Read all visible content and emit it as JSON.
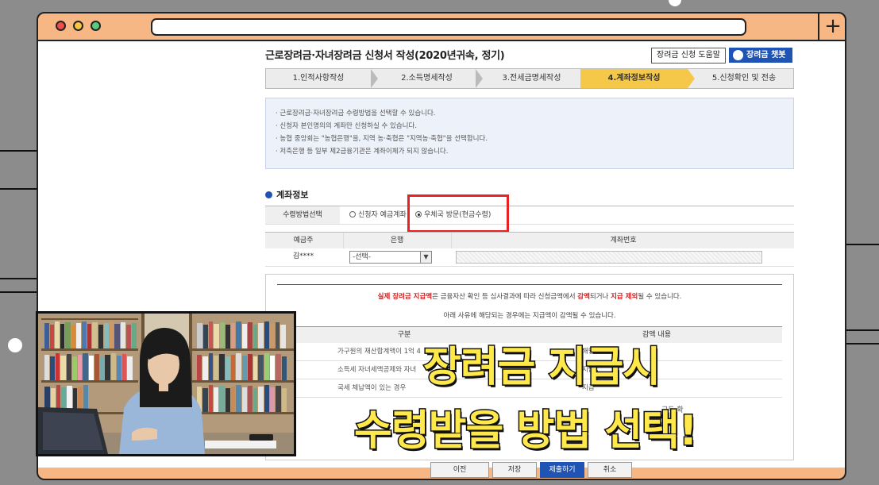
{
  "browser": {
    "window_buttons": [
      "close",
      "minimize",
      "maximize"
    ],
    "new_tab_label": "+"
  },
  "form": {
    "title": "근로장려금·자녀장려금 신청서 작성(2020년귀속, 정기)",
    "help_button": "장려금 신청 도움말",
    "chatbot_button": "장려금 챗봇",
    "steps": [
      "1.인적사항작성",
      "2.소득명세작성",
      "3.전세금명세작성",
      "4.계좌정보작성",
      "5.신청확인 및 전송"
    ],
    "active_step": 4,
    "info_lines": [
      "근로장려금·자녀장려금 수령방법을 선택할 수 있습니다.",
      "신청자 본인명의의 계좌만 신청하실 수 있습니다.",
      "농협 중앙회는 \"농협은행\"을, 지역 농·축협은 \"지역농·축협\"을 선택합니다.",
      "저축은행 등 일부 제2금융기관은 계좌이체가 되지 않습니다."
    ],
    "section_title": "계좌정보",
    "method_label": "수령방법선택",
    "method_options": [
      "신청자 예금계좌",
      "우체국 방문(현금수령)"
    ],
    "method_selected": "우체국 방문(현금수령)",
    "account_headers": {
      "holder": "예금주",
      "bank": "은행",
      "number": "계좌번호"
    },
    "account_row": {
      "holder": "김****",
      "bank": "-선택-",
      "number": ""
    },
    "notice": {
      "line1_a": "실제 장려금 지급액",
      "line1_b": "은 금융자산 확인 등 심사결과에 따라 신청금액에서 ",
      "line1_c": "감액",
      "line1_d": "되거나 ",
      "line1_e": "지급 제외",
      "line1_f": "될 수 있습니다.",
      "line2": "아래 사유에 해당되는 경우에는 지급액이 감액될 수 있습니다.",
      "table_headers": [
        "구분",
        "감액 내용"
      ],
      "rows": [
        [
          "가구원의 재산합계액이 1억 4",
          "해당"
        ],
        [
          "소득세 자녀세액공제와 자녀",
          "지급"
        ],
        [
          "국세 체납액이 있는 경우",
          "지급"
        ]
      ],
      "extra_text": "구두 확"
    },
    "bottom_buttons": [
      "이전",
      "저장",
      "제출하기",
      "취소"
    ]
  },
  "caption": {
    "line1": "장려금 지급시",
    "line2": "수령받을 방법 선택!"
  }
}
